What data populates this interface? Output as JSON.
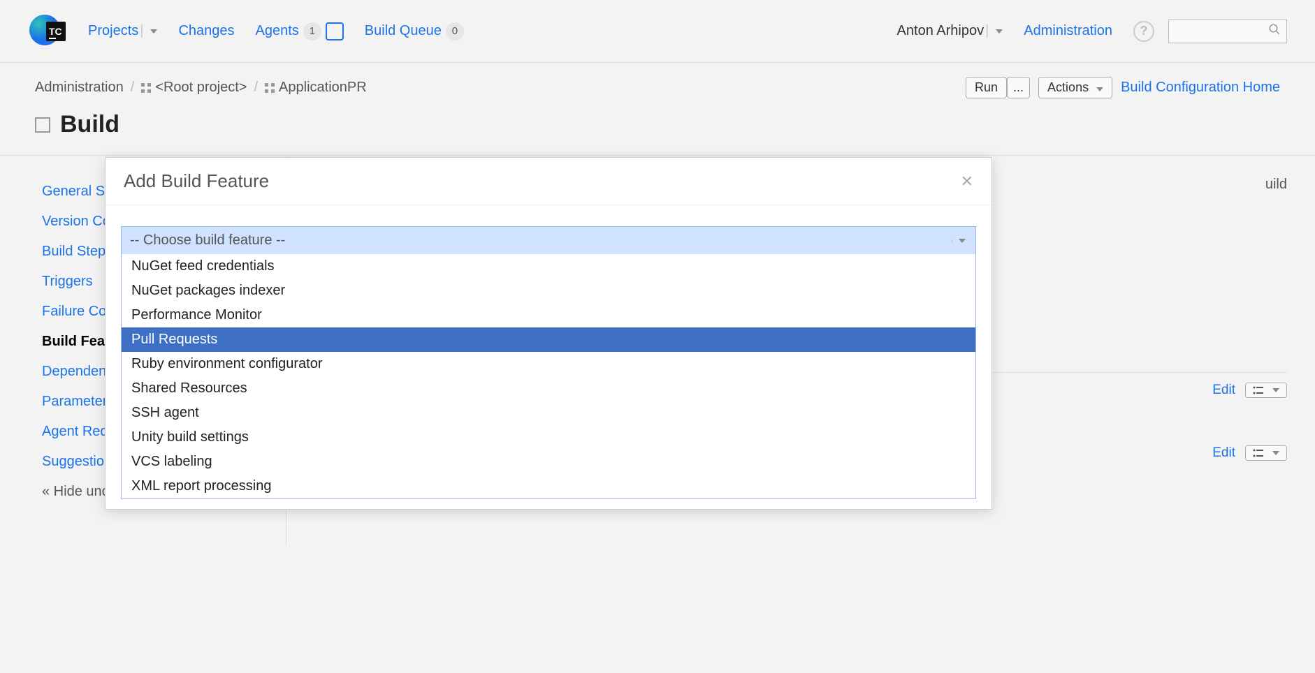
{
  "nav": {
    "projects": "Projects",
    "changes": "Changes",
    "agents": "Agents",
    "agents_count": "1",
    "build_queue": "Build Queue",
    "queue_count": "0",
    "user": "Anton Arhipov",
    "administration": "Administration"
  },
  "breadcrumb": {
    "root": "Administration",
    "project": "<Root project>",
    "app": "ApplicationPR"
  },
  "header_actions": {
    "run": "Run",
    "dots": "...",
    "actions": "Actions",
    "home": "Build Configuration Home"
  },
  "page_title": "Build",
  "sidebar": {
    "items": [
      {
        "label": "General Settings"
      },
      {
        "label": "Version Control"
      },
      {
        "label": "Build Steps"
      },
      {
        "label": "Triggers"
      },
      {
        "label": "Failure Conditions"
      },
      {
        "label": "Build Features"
      },
      {
        "label": "Dependencies"
      },
      {
        "label": "Parameters"
      },
      {
        "label": "Agent Requirements"
      },
      {
        "label": "Suggestions"
      }
    ],
    "hide": "« Hide unconfigured"
  },
  "main": {
    "partial": "uild",
    "edit": "Edit"
  },
  "modal": {
    "title": "Add Build Feature",
    "placeholder": "-- Choose build feature --",
    "options": [
      "NuGet feed credentials",
      "NuGet packages indexer",
      "Performance Monitor",
      "Pull Requests",
      "Ruby environment configurator",
      "Shared Resources",
      "SSH agent",
      "Unity build settings",
      "VCS labeling",
      "XML report processing"
    ],
    "highlight_index": 3
  }
}
